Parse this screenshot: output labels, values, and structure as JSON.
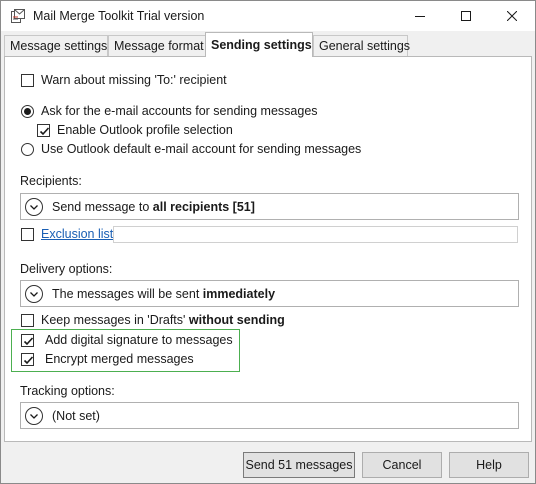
{
  "window": {
    "title": "Mail Merge Toolkit Trial version"
  },
  "tabs": [
    {
      "label": "Message settings",
      "active": false
    },
    {
      "label": "Message format",
      "active": false
    },
    {
      "label": "Sending settings",
      "active": true
    },
    {
      "label": "General settings",
      "active": false
    }
  ],
  "options": {
    "warn_missing_to": {
      "label": "Warn about missing 'To:' recipient",
      "checked": false
    },
    "ask_accounts": {
      "label": "Ask for the e-mail accounts for sending messages",
      "selected": true
    },
    "enable_outlook_profile": {
      "label": "Enable Outlook profile selection",
      "checked": true
    },
    "use_default_account": {
      "label": "Use Outlook default e-mail account for sending messages",
      "selected": false
    }
  },
  "recipients": {
    "heading": "Recipients:",
    "dropdown_prefix": "Send message to ",
    "dropdown_value": "all recipients [51]",
    "exclusion_link": "Exclusion list",
    "exclusion_checked": false,
    "exclusion_value": ""
  },
  "delivery": {
    "heading": "Delivery options:",
    "dropdown_prefix": "The messages will be sent ",
    "dropdown_value": "immediately",
    "keep_drafts_prefix": "Keep messages in 'Drafts' ",
    "keep_drafts_bold": "without sending",
    "keep_drafts_checked": false,
    "digital_signature": {
      "label": "Add digital signature to messages",
      "checked": true
    },
    "encrypt": {
      "label": "Encrypt merged messages",
      "checked": true
    }
  },
  "tracking": {
    "heading": "Tracking options:",
    "dropdown_value": "(Not set)"
  },
  "footer": {
    "send_label": "Send 51 messages",
    "cancel_label": "Cancel",
    "help_label": "Help"
  },
  "colors": {
    "highlight_border": "#4caf50",
    "link": "#1a5fb4"
  }
}
